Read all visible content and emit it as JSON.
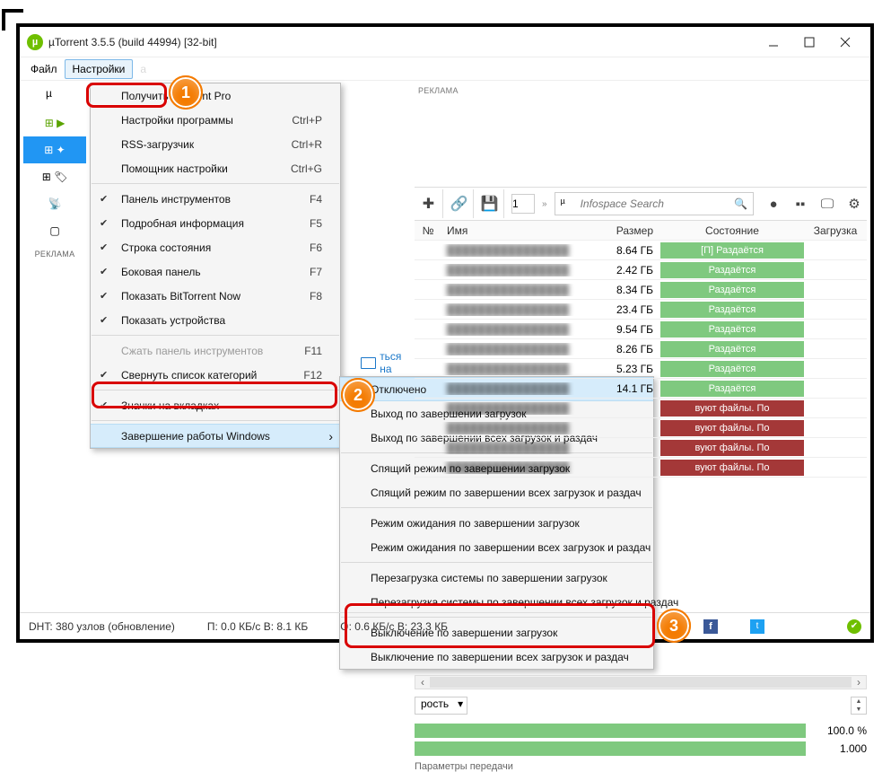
{
  "window": {
    "title": "µTorrent 3.5.5  (build 44994) [32-bit]"
  },
  "menu": {
    "file": "Файл",
    "settings": "Настройки"
  },
  "ad_label": "РЕКЛАМА",
  "settings_menu": [
    {
      "label": "Получить µTorrent Pro"
    },
    {
      "label": "Настройки программы",
      "shortcut": "Ctrl+P"
    },
    {
      "label": "RSS-загрузчик",
      "shortcut": "Ctrl+R"
    },
    {
      "label": "Помощник настройки",
      "shortcut": "Ctrl+G"
    },
    {
      "sep": true
    },
    {
      "label": "Панель инструментов",
      "shortcut": "F4",
      "checked": true
    },
    {
      "label": "Подробная информация",
      "shortcut": "F5",
      "checked": true
    },
    {
      "label": "Строка состояния",
      "shortcut": "F6",
      "checked": true
    },
    {
      "label": "Боковая панель",
      "shortcut": "F7",
      "checked": true
    },
    {
      "label": "Показать BitTorrent Now",
      "shortcut": "F8",
      "checked": true
    },
    {
      "label": "Показать устройства",
      "checked": true
    },
    {
      "sep": true
    },
    {
      "label": "Сжать панель инструментов",
      "shortcut": "F11",
      "disabled": true
    },
    {
      "label": "Свернуть список категорий",
      "shortcut": "F12",
      "checked": true
    },
    {
      "sep": true
    },
    {
      "label": "Значки на вкладках",
      "checked": true
    },
    {
      "sep": true
    },
    {
      "label": "Завершение работы Windows",
      "submenu": true,
      "highlight": true
    }
  ],
  "shutdown_menu": [
    "Отключено",
    "Выход по завершении загрузок",
    "Выход по завершении всех загрузок и раздач",
    "-",
    "Спящий режим по завершении загрузок",
    "Спящий режим по завершении всех загрузок и раздач",
    "-",
    "Режим ожидания по завершении загрузок",
    "Режим ожидания по завершении всех загрузок и раздач",
    "-",
    "Перезагрузка системы по завершении загрузок",
    "Перезагрузка системы по завершении всех загрузок и раздач",
    "-",
    "Выключение по завершении загрузок",
    "Выключение по завершении всех загрузок и раздач"
  ],
  "toolbar": {
    "page": "1",
    "search_placeholder": "Infospace Search"
  },
  "columns": {
    "num": "№",
    "name": "Имя",
    "size": "Размер",
    "state": "Состояние",
    "dl": "Загрузка"
  },
  "torrents": [
    {
      "size": "8.64 ГБ",
      "state": "[П] Раздаётся",
      "cls": "green"
    },
    {
      "size": "2.42 ГБ",
      "state": "Раздаётся",
      "cls": "green"
    },
    {
      "size": "8.34 ГБ",
      "state": "Раздаётся",
      "cls": "green"
    },
    {
      "size": "23.4 ГБ",
      "state": "Раздаётся",
      "cls": "green"
    },
    {
      "size": "9.54 ГБ",
      "state": "Раздаётся",
      "cls": "green"
    },
    {
      "size": "8.26 ГБ",
      "state": "Раздаётся",
      "cls": "green"
    },
    {
      "size": "5.23 ГБ",
      "state": "Раздаётся",
      "cls": "green"
    },
    {
      "size": "14.1 ГБ",
      "state": "Раздаётся",
      "cls": "green"
    },
    {
      "size": "",
      "state": "вуют файлы. По",
      "cls": "red"
    },
    {
      "size": "",
      "state": "вуют файлы. По",
      "cls": "red"
    },
    {
      "size": "",
      "state": "вуют файлы. По",
      "cls": "red"
    },
    {
      "size": "",
      "state": "вуют файлы. По",
      "cls": "red"
    }
  ],
  "summary": {
    "label": "рость"
  },
  "progress": {
    "p1": "100.0 %",
    "p2": "1.000"
  },
  "share": "ться на",
  "statusbar": {
    "dht": "DHT: 380 узлов  (обновление)",
    "disk": "П: 0.0 КБ/с В: 8.1 КБ",
    "net": "О: 0.6 КБ/с В: 23.3 КБ"
  },
  "bottom_caption": "Параметры передачи"
}
